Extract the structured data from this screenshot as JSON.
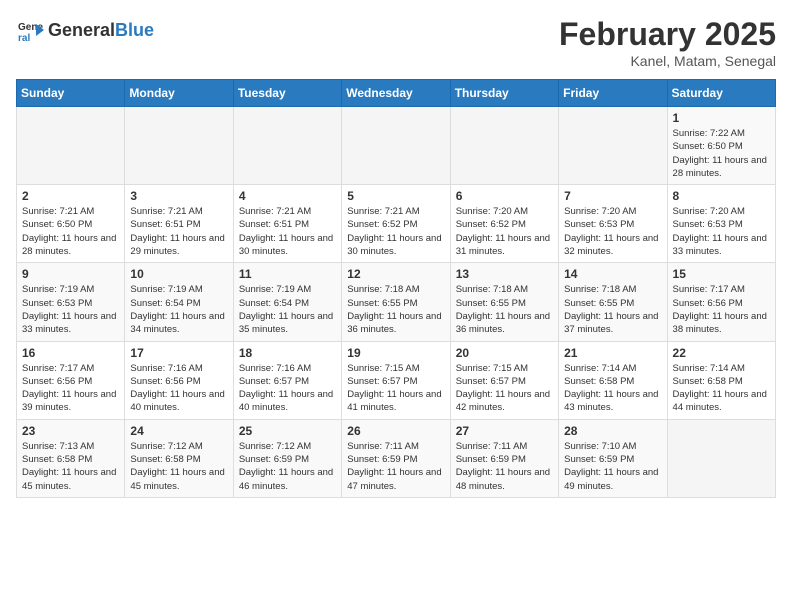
{
  "header": {
    "logo_general": "General",
    "logo_blue": "Blue",
    "month": "February 2025",
    "location": "Kanel, Matam, Senegal"
  },
  "weekdays": [
    "Sunday",
    "Monday",
    "Tuesday",
    "Wednesday",
    "Thursday",
    "Friday",
    "Saturday"
  ],
  "weeks": [
    [
      {
        "day": "",
        "info": ""
      },
      {
        "day": "",
        "info": ""
      },
      {
        "day": "",
        "info": ""
      },
      {
        "day": "",
        "info": ""
      },
      {
        "day": "",
        "info": ""
      },
      {
        "day": "",
        "info": ""
      },
      {
        "day": "1",
        "info": "Sunrise: 7:22 AM\nSunset: 6:50 PM\nDaylight: 11 hours and 28 minutes."
      }
    ],
    [
      {
        "day": "2",
        "info": "Sunrise: 7:21 AM\nSunset: 6:50 PM\nDaylight: 11 hours and 28 minutes."
      },
      {
        "day": "3",
        "info": "Sunrise: 7:21 AM\nSunset: 6:51 PM\nDaylight: 11 hours and 29 minutes."
      },
      {
        "day": "4",
        "info": "Sunrise: 7:21 AM\nSunset: 6:51 PM\nDaylight: 11 hours and 30 minutes."
      },
      {
        "day": "5",
        "info": "Sunrise: 7:21 AM\nSunset: 6:52 PM\nDaylight: 11 hours and 30 minutes."
      },
      {
        "day": "6",
        "info": "Sunrise: 7:20 AM\nSunset: 6:52 PM\nDaylight: 11 hours and 31 minutes."
      },
      {
        "day": "7",
        "info": "Sunrise: 7:20 AM\nSunset: 6:53 PM\nDaylight: 11 hours and 32 minutes."
      },
      {
        "day": "8",
        "info": "Sunrise: 7:20 AM\nSunset: 6:53 PM\nDaylight: 11 hours and 33 minutes."
      }
    ],
    [
      {
        "day": "9",
        "info": "Sunrise: 7:19 AM\nSunset: 6:53 PM\nDaylight: 11 hours and 33 minutes."
      },
      {
        "day": "10",
        "info": "Sunrise: 7:19 AM\nSunset: 6:54 PM\nDaylight: 11 hours and 34 minutes."
      },
      {
        "day": "11",
        "info": "Sunrise: 7:19 AM\nSunset: 6:54 PM\nDaylight: 11 hours and 35 minutes."
      },
      {
        "day": "12",
        "info": "Sunrise: 7:18 AM\nSunset: 6:55 PM\nDaylight: 11 hours and 36 minutes."
      },
      {
        "day": "13",
        "info": "Sunrise: 7:18 AM\nSunset: 6:55 PM\nDaylight: 11 hours and 36 minutes."
      },
      {
        "day": "14",
        "info": "Sunrise: 7:18 AM\nSunset: 6:55 PM\nDaylight: 11 hours and 37 minutes."
      },
      {
        "day": "15",
        "info": "Sunrise: 7:17 AM\nSunset: 6:56 PM\nDaylight: 11 hours and 38 minutes."
      }
    ],
    [
      {
        "day": "16",
        "info": "Sunrise: 7:17 AM\nSunset: 6:56 PM\nDaylight: 11 hours and 39 minutes."
      },
      {
        "day": "17",
        "info": "Sunrise: 7:16 AM\nSunset: 6:56 PM\nDaylight: 11 hours and 40 minutes."
      },
      {
        "day": "18",
        "info": "Sunrise: 7:16 AM\nSunset: 6:57 PM\nDaylight: 11 hours and 40 minutes."
      },
      {
        "day": "19",
        "info": "Sunrise: 7:15 AM\nSunset: 6:57 PM\nDaylight: 11 hours and 41 minutes."
      },
      {
        "day": "20",
        "info": "Sunrise: 7:15 AM\nSunset: 6:57 PM\nDaylight: 11 hours and 42 minutes."
      },
      {
        "day": "21",
        "info": "Sunrise: 7:14 AM\nSunset: 6:58 PM\nDaylight: 11 hours and 43 minutes."
      },
      {
        "day": "22",
        "info": "Sunrise: 7:14 AM\nSunset: 6:58 PM\nDaylight: 11 hours and 44 minutes."
      }
    ],
    [
      {
        "day": "23",
        "info": "Sunrise: 7:13 AM\nSunset: 6:58 PM\nDaylight: 11 hours and 45 minutes."
      },
      {
        "day": "24",
        "info": "Sunrise: 7:12 AM\nSunset: 6:58 PM\nDaylight: 11 hours and 45 minutes."
      },
      {
        "day": "25",
        "info": "Sunrise: 7:12 AM\nSunset: 6:59 PM\nDaylight: 11 hours and 46 minutes."
      },
      {
        "day": "26",
        "info": "Sunrise: 7:11 AM\nSunset: 6:59 PM\nDaylight: 11 hours and 47 minutes."
      },
      {
        "day": "27",
        "info": "Sunrise: 7:11 AM\nSunset: 6:59 PM\nDaylight: 11 hours and 48 minutes."
      },
      {
        "day": "28",
        "info": "Sunrise: 7:10 AM\nSunset: 6:59 PM\nDaylight: 11 hours and 49 minutes."
      },
      {
        "day": "",
        "info": ""
      }
    ]
  ]
}
